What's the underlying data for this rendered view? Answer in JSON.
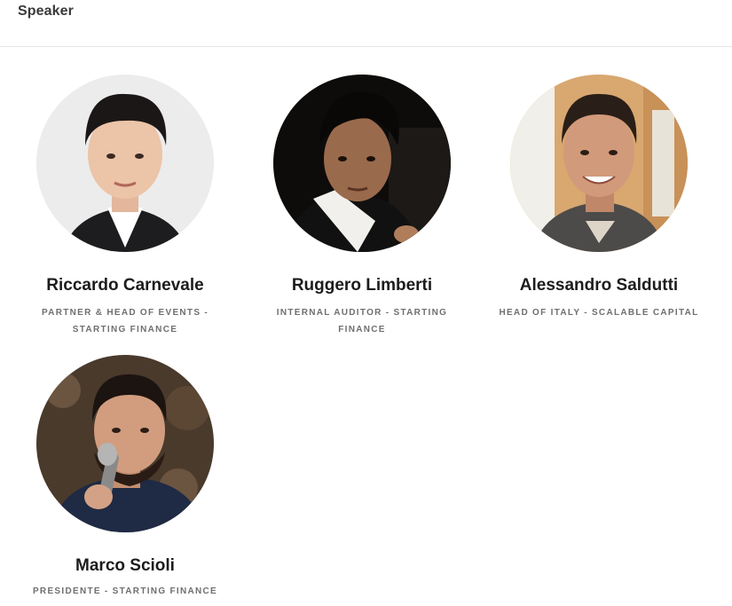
{
  "header": {
    "title": "Speaker"
  },
  "speakers": [
    {
      "name": "Riccardo Carnevale",
      "role": "PARTNER & HEAD OF EVENTS - STARTING FINANCE",
      "photo_icon": "speaker-photo"
    },
    {
      "name": "Ruggero Limberti",
      "role": "INTERNAL AUDITOR - STARTING FINANCE",
      "photo_icon": "speaker-photo"
    },
    {
      "name": "Alessandro Saldutti",
      "role": "HEAD OF ITALY - SCALABLE CAPITAL",
      "photo_icon": "speaker-photo"
    },
    {
      "name": "Marco Scioli",
      "role": "PRESIDENTE - STARTING FINANCE",
      "photo_icon": "speaker-photo"
    }
  ]
}
